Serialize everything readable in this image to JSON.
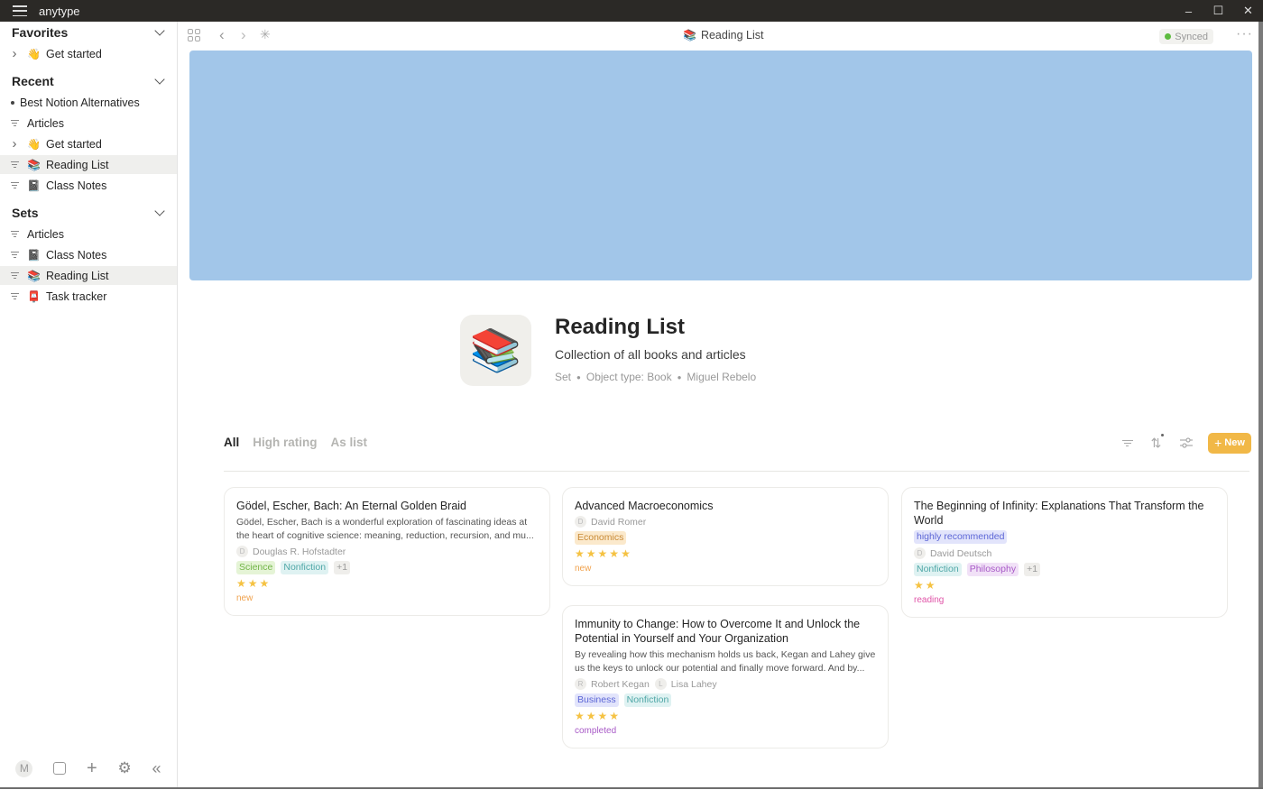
{
  "window": {
    "app_name": "anytype",
    "minimize": "–",
    "maximize": "☐",
    "close": "✕"
  },
  "sidebar": {
    "favorites": {
      "title": "Favorites",
      "items": [
        {
          "label": "Get started",
          "emoji": "👋"
        }
      ]
    },
    "recent": {
      "title": "Recent",
      "items": [
        {
          "label": "Best Notion Alternatives",
          "emoji": ""
        },
        {
          "label": "Articles",
          "emoji": ""
        },
        {
          "label": "Get started",
          "emoji": "👋"
        },
        {
          "label": "Reading List",
          "emoji": "📚"
        },
        {
          "label": "Class Notes",
          "emoji": "📓"
        }
      ]
    },
    "sets": {
      "title": "Sets",
      "items": [
        {
          "label": "Articles",
          "emoji": ""
        },
        {
          "label": "Class Notes",
          "emoji": "📓"
        },
        {
          "label": "Reading List",
          "emoji": "📚"
        },
        {
          "label": "Task tracker",
          "emoji": "📮"
        }
      ]
    },
    "bottom": {
      "avatar_initial": "M"
    }
  },
  "toolbar": {
    "breadcrumb": "Reading List",
    "breadcrumb_emoji": "📚",
    "sync_status": "Synced",
    "more": "···"
  },
  "page": {
    "icon": "📚",
    "title": "Reading List",
    "description": "Collection of all books and articles",
    "meta": [
      "Set",
      "Object type: Book",
      "Miguel Rebelo"
    ]
  },
  "views": {
    "tabs": [
      "All",
      "High rating",
      "As list"
    ],
    "active": 0,
    "new_button": "New"
  },
  "colors": {
    "accent": "#f1b847",
    "cover": "#a2c6e9",
    "star": "#f5c242"
  },
  "cards": [
    {
      "title": "Gödel, Escher, Bach: An Eternal Golden Braid",
      "description": "Gödel, Escher, Bach is a wonderful exploration of fascinating ideas at the heart of cognitive science: meaning, reduction, recursion, and mu...",
      "authors": [
        {
          "initial": "D",
          "name": "Douglas R. Hofstadter"
        }
      ],
      "tags": [
        {
          "label": "Science",
          "bg": "#e5f4d6",
          "fg": "#72b548"
        },
        {
          "label": "Nonfiction",
          "bg": "#dff2f2",
          "fg": "#4fa7a7"
        },
        {
          "label": "+1",
          "bg": "#efeeeb",
          "fg": "#999"
        }
      ],
      "rating": 3,
      "status": {
        "label": "new",
        "color": "#f0a24d"
      }
    },
    {
      "title": "Advanced Macroeconomics",
      "description": "",
      "authors": [
        {
          "initial": "D",
          "name": "David Romer"
        }
      ],
      "tags": [
        {
          "label": "Economics",
          "bg": "#fbe9cc",
          "fg": "#c98a35"
        }
      ],
      "rating": 5,
      "status": {
        "label": "new",
        "color": "#f0a24d"
      }
    },
    {
      "title": "The Beginning of Infinity: Explanations That Transform the World",
      "badge": {
        "label": "highly recommended",
        "bg": "#e2e4fb",
        "fg": "#5c66d6"
      },
      "description": "",
      "authors": [
        {
          "initial": "D",
          "name": "David Deutsch"
        }
      ],
      "tags": [
        {
          "label": "Nonfiction",
          "bg": "#dff2f2",
          "fg": "#4fa7a7"
        },
        {
          "label": "Philosophy",
          "bg": "#f1e1f7",
          "fg": "#a85ac7"
        },
        {
          "label": "+1",
          "bg": "#efeeeb",
          "fg": "#999"
        }
      ],
      "rating": 2,
      "status": {
        "label": "reading",
        "color": "#e054a8"
      }
    },
    {
      "title": "Immunity to Change: How to Overcome It and Unlock the Potential in Yourself and Your Organization",
      "description": "By revealing how this mechanism holds us back, Kegan and Lahey give us the keys to unlock our potential and finally move forward. And by...",
      "authors": [
        {
          "initial": "R",
          "name": "Robert Kegan"
        },
        {
          "initial": "L",
          "name": "Lisa Lahey"
        }
      ],
      "tags": [
        {
          "label": "Business",
          "bg": "#e2e4fb",
          "fg": "#5c66d6"
        },
        {
          "label": "Nonfiction",
          "bg": "#dff2f2",
          "fg": "#4fa7a7"
        }
      ],
      "rating": 4,
      "status": {
        "label": "completed",
        "color": "#a85ac7"
      }
    }
  ],
  "help": "?"
}
